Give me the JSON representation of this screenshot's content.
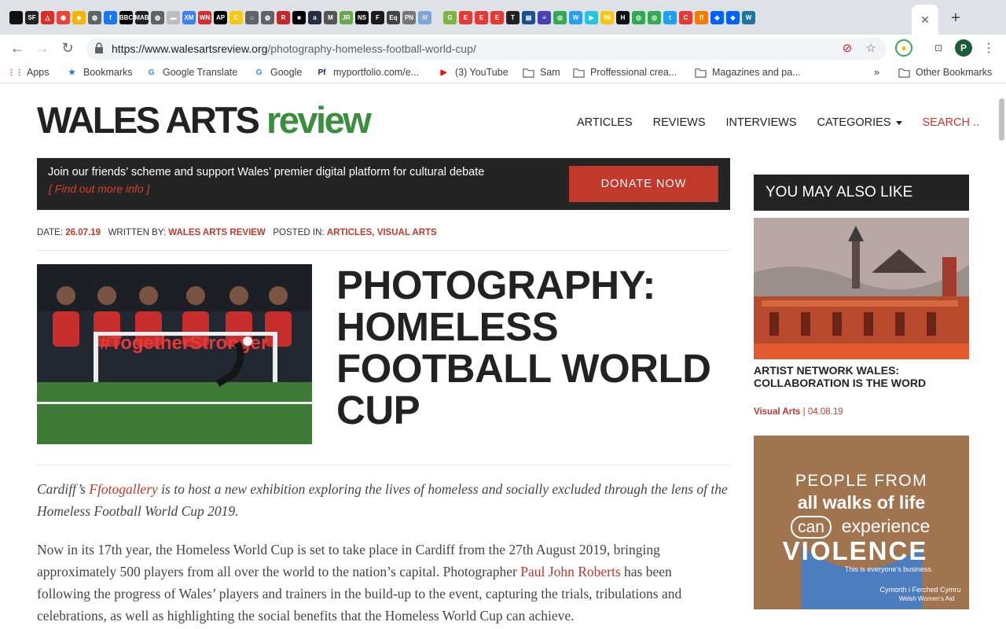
{
  "browser": {
    "tab_favicons": [
      {
        "icon": "black-hexagon",
        "color": "#111111",
        "glyph": ""
      },
      {
        "icon": "sf-favicon",
        "color": "#222222",
        "glyph": "SF"
      },
      {
        "icon": "red-flag-favicon",
        "color": "#d93025",
        "glyph": "△"
      },
      {
        "icon": "red-dragon-favicon",
        "color": "#e8453c",
        "glyph": "◉"
      },
      {
        "icon": "colorful-favicon",
        "color": "#f4b400",
        "glyph": "◆"
      },
      {
        "icon": "globe-favicon",
        "color": "#5f6368",
        "glyph": "◍"
      },
      {
        "icon": "facebook-favicon",
        "color": "#1877f2",
        "glyph": "f"
      },
      {
        "icon": "bbc-favicon",
        "color": "#000000",
        "glyph": "BBC"
      },
      {
        "icon": "mab-favicon",
        "color": "#222222",
        "glyph": "MAB"
      },
      {
        "icon": "globe-favicon",
        "color": "#5f6368",
        "glyph": "◍"
      },
      {
        "icon": "grey-page-favicon",
        "color": "#bdbdbd",
        "glyph": "▬"
      },
      {
        "icon": "xm-favicon",
        "color": "#3b82f6",
        "glyph": "XM"
      },
      {
        "icon": "wn-favicon",
        "color": "#d32f2f",
        "glyph": "WN"
      },
      {
        "icon": "ap-favicon",
        "color": "#000000",
        "glyph": "AP"
      },
      {
        "icon": "yellow-c-favicon",
        "color": "#f9c80e",
        "glyph": "C"
      },
      {
        "icon": "house-favicon",
        "color": "#5f6368",
        "glyph": "⌂"
      },
      {
        "icon": "globe-favicon",
        "color": "#5f6368",
        "glyph": "◍"
      },
      {
        "icon": "r-favicon",
        "color": "#c62828",
        "glyph": "R"
      },
      {
        "icon": "black-square-favicon",
        "color": "#000000",
        "glyph": "■"
      },
      {
        "icon": "amazon-favicon",
        "color": "#232f3e",
        "glyph": "a"
      },
      {
        "icon": "m-favicon",
        "color": "#555555",
        "glyph": "M"
      },
      {
        "icon": "jr-favicon",
        "color": "#6aa84f",
        "glyph": "JR"
      },
      {
        "icon": "ns-favicon",
        "color": "#111111",
        "glyph": "NS"
      },
      {
        "icon": "f-favicon",
        "color": "#1b1b1b",
        "glyph": "F"
      },
      {
        "icon": "eq-favicon",
        "color": "#444444",
        "glyph": "Eq"
      },
      {
        "icon": "pinot-favicon",
        "color": "#777777",
        "glyph": "PN"
      },
      {
        "icon": "stripes-favicon",
        "color": "#7aa7d8",
        "glyph": "///"
      },
      {
        "icon": "g-green-favicon",
        "color": "#7cb342",
        "glyph": "G"
      },
      {
        "icon": "e-red-favicon",
        "color": "#e53935",
        "glyph": "E"
      },
      {
        "icon": "e-red-favicon",
        "color": "#e53935",
        "glyph": "E"
      },
      {
        "icon": "e-red-favicon",
        "color": "#e53935",
        "glyph": "E"
      },
      {
        "icon": "t-favicon",
        "color": "#222222",
        "glyph": "T"
      },
      {
        "icon": "blue-box-favicon",
        "color": "#1e4e8c",
        "glyph": "▤"
      },
      {
        "icon": "list-favicon",
        "color": "#4b3fb5",
        "glyph": "≡"
      },
      {
        "icon": "chrome-favicon",
        "color": "#34a853",
        "glyph": "◎"
      },
      {
        "icon": "w-favicon",
        "color": "#2a9df4",
        "glyph": "W"
      },
      {
        "icon": "cyan-favicon",
        "color": "#26c6da",
        "glyph": "▶"
      },
      {
        "icon": "imdb-favicon",
        "color": "#f5c518",
        "glyph": "IM"
      },
      {
        "icon": "h-favicon",
        "color": "#111111",
        "glyph": "H"
      },
      {
        "icon": "chrome-favicon",
        "color": "#34a853",
        "glyph": "◎"
      },
      {
        "icon": "chrome-favicon",
        "color": "#34a853",
        "glyph": "◎"
      },
      {
        "icon": "twitter-favicon",
        "color": "#1da1f2",
        "glyph": "t"
      },
      {
        "icon": "c-red-favicon",
        "color": "#e53935",
        "glyph": "C"
      },
      {
        "icon": "ff-favicon",
        "color": "#f57c00",
        "glyph": "ff"
      },
      {
        "icon": "dropbox-favicon",
        "color": "#0061ff",
        "glyph": "◆"
      },
      {
        "icon": "dropbox-favicon",
        "color": "#0061ff",
        "glyph": "◆"
      },
      {
        "icon": "wordpress-favicon",
        "color": "#21759b",
        "glyph": "W"
      }
    ],
    "active_tab_close": "✕",
    "new_tab": "+",
    "url_domain": "https://www.walesartsreview.org",
    "url_path": "/photography-homeless-football-world-cup/",
    "bookmarks": [
      {
        "label": "Apps",
        "icon": "apps-grid-icon",
        "glyph": "⋮⋮",
        "color": "#e53935"
      },
      {
        "label": "Bookmarks",
        "icon": "star-icon",
        "glyph": "★",
        "color": "#1a73e8"
      },
      {
        "label": "Google Translate",
        "icon": "google-translate-icon",
        "glyph": "G",
        "color": "#4285f4"
      },
      {
        "label": "Google",
        "icon": "google-icon",
        "glyph": "G",
        "color": "#4285f4"
      },
      {
        "label": "myportfolio.com/e...",
        "icon": "portfolio-icon",
        "glyph": "Pf",
        "color": "#0b2b6b"
      },
      {
        "label": "(3) YouTube",
        "icon": "youtube-icon",
        "glyph": "▶",
        "color": "#ff0000"
      },
      {
        "label": "Sam",
        "icon": "folder-icon",
        "glyph": "",
        "color": "#5f6368"
      },
      {
        "label": "Proffessional crea...",
        "icon": "folder-icon",
        "glyph": "",
        "color": "#5f6368"
      },
      {
        "label": "Magazines and pa...",
        "icon": "folder-icon",
        "glyph": "",
        "color": "#5f6368"
      }
    ],
    "bookmarks_overflow": "»",
    "other_bookmarks": "Other Bookmarks",
    "profile_initial": "P"
  },
  "site": {
    "logo_main": "WALES ARTS",
    "logo_accent": "review",
    "nav": [
      "ARTICLES",
      "REVIEWS",
      "INTERVIEWS",
      "CATEGORIES"
    ],
    "search_label": "SEARCH .."
  },
  "promo": {
    "text": "Join our friends’ scheme and support Wales’ premier digital platform for cultural debate",
    "link": "[ Find out more info ]",
    "button": "DONATE NOW"
  },
  "article": {
    "date_label": "DATE:",
    "date": "26.07.19",
    "author_label": "WRITTEN BY:",
    "author": "WALES ARTS REVIEW",
    "posted_label": "POSTED IN:",
    "categories": [
      "ARTICLES",
      "VISUAL ARTS"
    ],
    "title": "PHOTOGRAPHY: HOMELESS FOOTBALL WORLD CUP",
    "hero_banner_text": "#TogetherStronger",
    "lede_before": "Cardiff’s ",
    "lede_link": "Ffotogallery",
    "lede_after": " is to host a new exhibition exploring the lives of homeless and socially excluded through the lens of the Homeless Football World Cup 2019.",
    "body_before": "Now in its 17th year, the Homeless World Cup is set to take place in Cardiff from the 27th August 2019, bringing approximately 500 players from all over the world to the nation’s capital. Photographer ",
    "body_link": "Paul John Roberts",
    "body_after": " has been following the progress of Wales’ players and trainers in the build-up to the event, capturing the trials, tribulations and celebrations, as well as highlighting the social benefits that the Homeless World Cup can achieve."
  },
  "sidebar": {
    "heading": "YOU MAY ALSO LIKE",
    "items": [
      {
        "title": "ARTIST NETWORK WALES: COLLABORATION IS THE WORD",
        "category": "Visual Arts",
        "date": "04.08.19"
      }
    ],
    "poster": {
      "line1": "PEOPLE FROM",
      "line2": "all walks of life",
      "line3a": "can",
      "line3b": "experience",
      "line4": "VIOLENCE",
      "tag": "This is everyone's business.",
      "org1": "Cymorth i Ferched Cymru",
      "org2": "Welsh Women's Aid"
    }
  },
  "colors": {
    "accent_red": "#c0392b",
    "logo_green": "#3a8f3f",
    "dark_bar": "#242424"
  }
}
